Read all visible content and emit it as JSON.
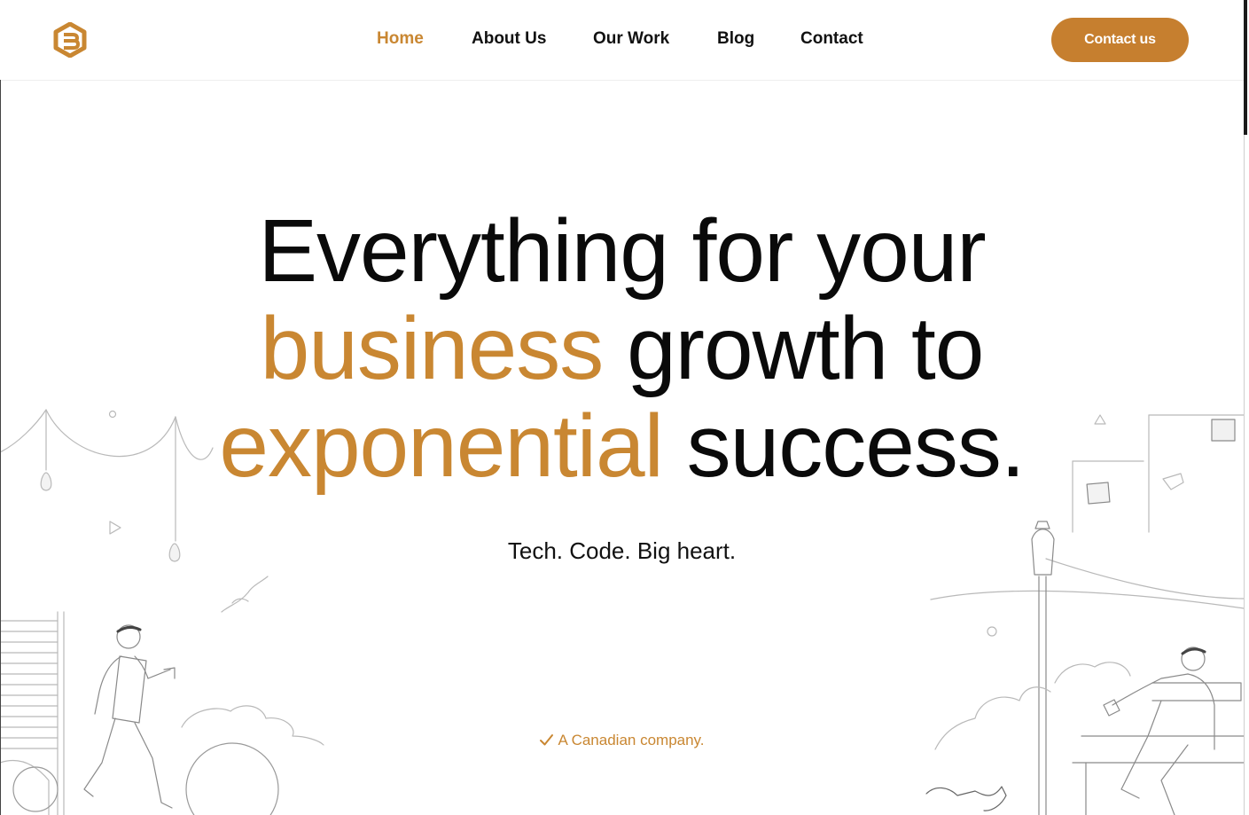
{
  "header": {
    "logo_name": "hexagon-b-logo",
    "nav": [
      {
        "label": "Home",
        "active": true
      },
      {
        "label": "About Us",
        "active": false
      },
      {
        "label": "Our Work",
        "active": false
      },
      {
        "label": "Blog",
        "active": false
      },
      {
        "label": "Contact",
        "active": false
      }
    ],
    "cta_label": "Contact us"
  },
  "hero": {
    "line1": "Everything for your",
    "line2_accent": "business",
    "line2_rest": " growth to",
    "line3_accent": "exponential",
    "line3_rest": " success.",
    "tagline": "Tech. Code. Big heart.",
    "badge": "A Canadian company."
  },
  "colors": {
    "accent": "#c98732",
    "cta_background": "#c67f2f",
    "text": "#0a0a0a",
    "background": "#ffffff"
  }
}
